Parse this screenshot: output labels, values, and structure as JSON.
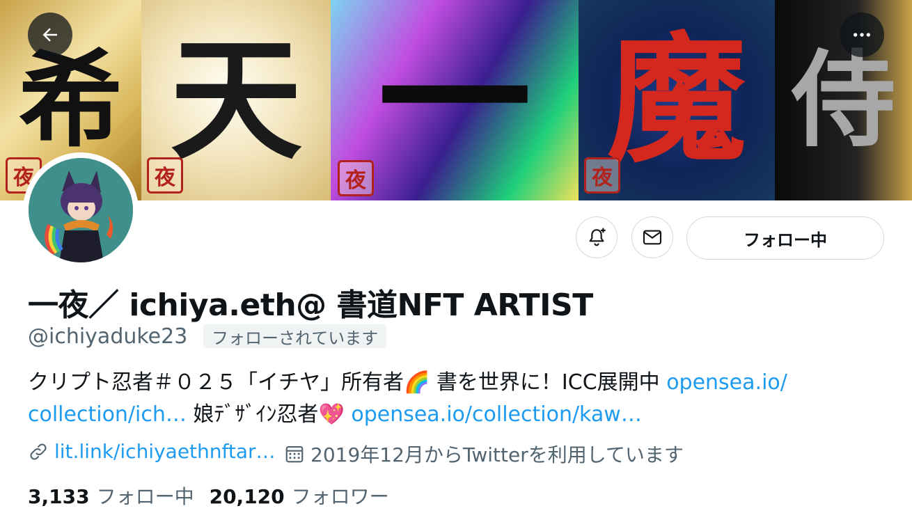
{
  "banner": {
    "panels": [
      {
        "kanji": "希",
        "seal": "夜"
      },
      {
        "kanji": "天",
        "seal": "夜"
      },
      {
        "kanji": "一",
        "seal": "夜"
      },
      {
        "kanji": "魔",
        "seal": "夜"
      },
      {
        "kanji": "侍",
        "seal": ""
      }
    ]
  },
  "nav": {
    "back_icon": "arrow-left-icon",
    "more_icon": "more-horizontal-icon"
  },
  "actions": {
    "notify_icon": "bell-plus-icon",
    "message_icon": "envelope-icon",
    "follow_label": "フォロー中"
  },
  "profile": {
    "display_name": "一夜／ ichiya.eth@ 書道NFT ARTIST",
    "handle": "@ichiyaduke23",
    "follows_you": "フォローされています",
    "bio": {
      "text1": "クリプト忍者＃０２５「イチヤ」所有者",
      "emoji1": "🌈",
      "text2": " 書を世界に！ICC展開中 ",
      "link1a": "opensea.io/",
      "link1b": "collection/ich…",
      "text3": " 娘ﾃﾞｻﾞｲﾝ忍者",
      "emoji2": "💖",
      "link2": "opensea.io/collection/kaw…"
    },
    "website": "lit.link/ichiyaethnftar…",
    "joined": "2019年12月からTwitterを利用しています",
    "following_count": "3,133",
    "following_label": "フォロー中",
    "followers_count": "20,120",
    "followers_label": "フォロワー"
  },
  "colors": {
    "accent": "#1d9bf0",
    "text_secondary": "#536471",
    "border": "#cfd9de"
  }
}
